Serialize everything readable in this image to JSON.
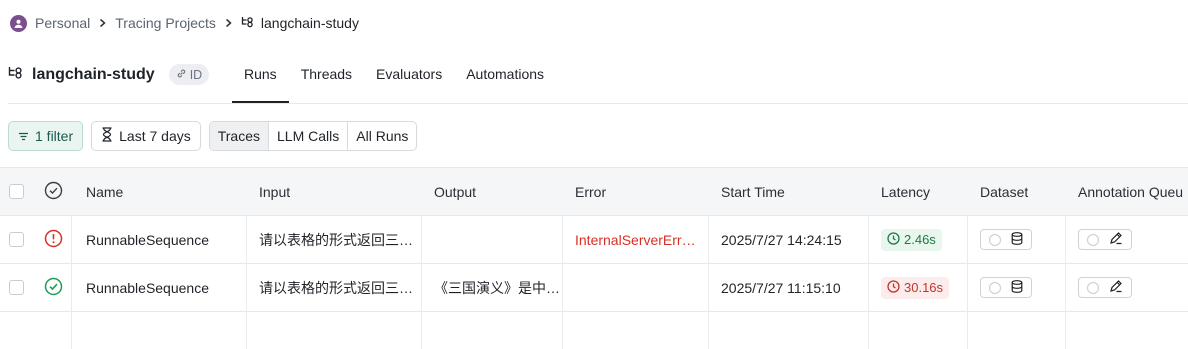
{
  "breadcrumb": {
    "items": [
      "Personal",
      "Tracing Projects"
    ],
    "current": "langchain-study"
  },
  "header": {
    "project_title": "langchain-study",
    "id_label": "ID",
    "tabs": [
      {
        "label": "Runs",
        "active": true
      },
      {
        "label": "Threads",
        "active": false
      },
      {
        "label": "Evaluators",
        "active": false
      },
      {
        "label": "Automations",
        "active": false
      }
    ]
  },
  "filters": {
    "filter_label": "1 filter",
    "time_label": "Last 7 days",
    "segments": [
      {
        "label": "Traces",
        "selected": true
      },
      {
        "label": "LLM Calls",
        "selected": false
      },
      {
        "label": "All Runs",
        "selected": false
      }
    ]
  },
  "table": {
    "columns": [
      "Name",
      "Input",
      "Output",
      "Error",
      "Start Time",
      "Latency",
      "Dataset",
      "Annotation Queu"
    ],
    "rows": [
      {
        "status": "error",
        "name": "RunnableSequence",
        "input": "请以表格的形式返回三…",
        "output": "",
        "error": "InternalServerErr…",
        "start_time": "2025/7/27 14:24:15",
        "latency": "2.46s",
        "latency_status": "ok"
      },
      {
        "status": "success",
        "name": "RunnableSequence",
        "input": "请以表格的形式返回三…",
        "output": "《三国演义》是中…",
        "error": "",
        "start_time": "2025/7/27 11:15:10",
        "latency": "30.16s",
        "latency_status": "slow"
      }
    ]
  },
  "colors": {
    "error": "#d93025",
    "success": "#1e9b55",
    "avatar": "#7a4f8e"
  }
}
